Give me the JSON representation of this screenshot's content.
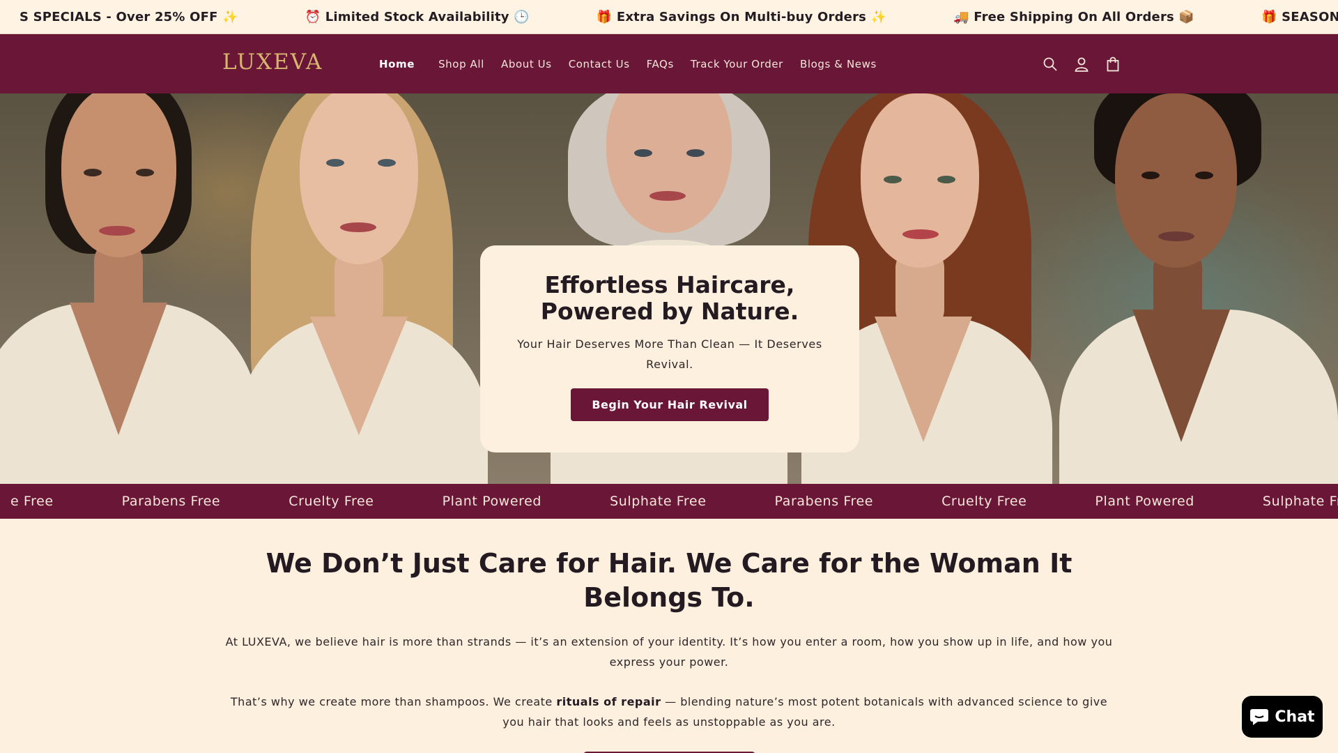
{
  "announcement": {
    "items": [
      "S SPECIALS - Over 25% OFF ✨",
      "⏰ Limited Stock Availability 🕒",
      "🎁 Extra Savings On Multi-buy Orders ✨",
      "🚚 Free Shipping On All Orders 📦",
      "🎁 SEASONS SPEC"
    ]
  },
  "header": {
    "logo": "LUXEVA",
    "nav": [
      "Home",
      "Shop All",
      "About Us",
      "Contact Us",
      "FAQs",
      "Track Your Order",
      "Blogs & News"
    ],
    "icons": [
      "search-icon",
      "account-icon",
      "cart-icon"
    ]
  },
  "hero": {
    "title": "Effortless Haircare, Powered by Nature.",
    "subtitle": "Your Hair Deserves More Than Clean — It Deserves Revival.",
    "button": "Begin Your Hair Revival"
  },
  "marquee": {
    "items": [
      "e Free",
      "Parabens Free",
      "Cruelty Free",
      "Plant Powered",
      "Sulphate Free",
      "Parabens Free",
      "Cruelty Free",
      "Plant Powered",
      "Sulphate Free"
    ]
  },
  "content": {
    "heading": "We Don’t Just Care for Hair. We Care for the Woman It Belongs To.",
    "paragraph1": "At LUXEVA, we believe hair is more than strands — it’s an extension of your identity. It’s how you enter a room, how you show up in life, and how you express your power.",
    "paragraph2_before": "That’s why we create more than shampoos. We create ",
    "paragraph2_bold": "rituals of repair",
    "paragraph2_after": " — blending nature’s most potent botanicals with advanced science to give you hair that looks and feels as unstoppable as you are."
  },
  "chat": {
    "label": "Chat"
  },
  "colors": {
    "brand": "#6a1636",
    "gold": "#d8b56e",
    "cream": "#fdf0df"
  }
}
